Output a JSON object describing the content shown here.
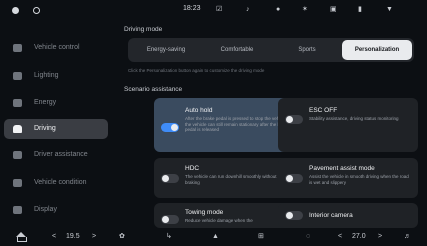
{
  "status_bar": {
    "time": "18:23",
    "icons": [
      "avatar-icon",
      "ring-icon",
      "phone-icon",
      "mute-icon",
      "wifi-icon",
      "bluetooth-icon",
      "camera-icon",
      "battery-icon",
      "signal-icon"
    ]
  },
  "sidebar": {
    "items": [
      {
        "label": "Vehicle control",
        "icon": "car-control-icon"
      },
      {
        "label": "Lighting",
        "icon": "light-icon"
      },
      {
        "label": "Energy",
        "icon": "battery-energy-icon"
      },
      {
        "label": "Driving",
        "icon": "car-icon",
        "active": true
      },
      {
        "label": "Driver assistance",
        "icon": "assist-icon"
      },
      {
        "label": "Vehicle condition",
        "icon": "condition-icon"
      },
      {
        "label": "Display",
        "icon": "display-icon"
      }
    ]
  },
  "main": {
    "driving_mode_title": "Driving mode",
    "modes": [
      "Energy-saving",
      "Comfortable",
      "Sports",
      "Personalization"
    ],
    "active_mode": "Personalization",
    "mode_hint": "Click the Personalization button again to customize the driving mode",
    "scenario_title": "Scenario assistance",
    "cards": [
      {
        "title": "Auto hold",
        "desc": "After the brake pedal is pressed to stop the vehicle, the vehicle can still remain stationary after the brake pedal is released",
        "on": true
      },
      {
        "title": "ESC OFF",
        "desc": "Stability assistance, driving status monitoring",
        "on": false
      },
      {
        "title": "HDC",
        "desc": "The vehicle can run downhill smoothly without braking",
        "on": false
      },
      {
        "title": "Pavement assist mode",
        "desc": "Assist the vehicle in smooth driving when the road is wet and slippery",
        "on": false
      },
      {
        "title": "Towing mode",
        "desc": "Reduce vehicle damage when the",
        "on": false
      },
      {
        "title": "Interior camera",
        "desc": "",
        "on": false
      }
    ]
  },
  "bottom_bar": {
    "left_temp": "19.5",
    "right_temp": "27.0",
    "decrease_symbol": "<",
    "increase_symbol": ">"
  }
}
